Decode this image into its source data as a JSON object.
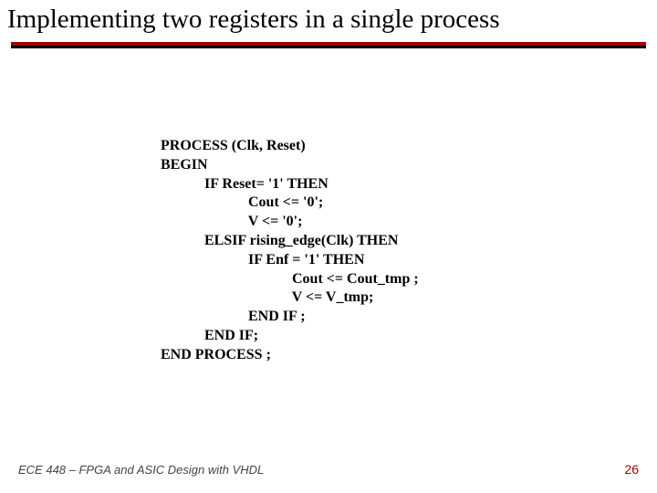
{
  "title": "Implementing two registers in a single process",
  "code": {
    "l1": "PROCESS (Clk, Reset)",
    "l2": "BEGIN",
    "l3": "            IF Reset= '1' THEN",
    "l4": "                        Cout <= '0';",
    "l5": "                        V <= '0';",
    "l6": "            ELSIF rising_edge(Clk) THEN",
    "l7": "                        IF Enf = '1' THEN",
    "l8": "                                    Cout <= Cout_tmp ;",
    "l9": "                                    V <= V_tmp;",
    "l10": "                        END IF ;",
    "l11": "            END IF;",
    "l12": "END PROCESS ;"
  },
  "footer": {
    "course": "ECE 448 – FPGA and ASIC Design with VHDL",
    "page": "26"
  }
}
